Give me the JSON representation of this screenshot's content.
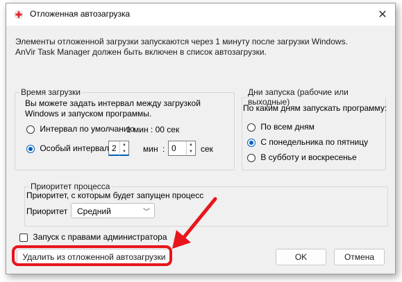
{
  "window": {
    "title": "Отложенная автозагрузка",
    "close_label": "✕"
  },
  "intro": {
    "line1": "Элементы отложенной загрузки запускаются через 1 минуту после загрузки Windows.",
    "line2": "AnVir Task Manager должен быть включен в список автозагрузки."
  },
  "time_group": {
    "legend": "Время загрузки",
    "desc1": "Вы можете задать интервал между загрузкой",
    "desc2": "Windows и запуском программы.",
    "default_label": "Интервал по умолчанию",
    "default_value": "1 мин : 00 сек",
    "custom_label": "Особый интервал",
    "minutes_value": "2",
    "minutes_unit": "мин",
    "colon": ":",
    "seconds_value": "0",
    "seconds_unit": "сек",
    "selected": "custom"
  },
  "days_group": {
    "legend": "Дни запуска (рабочие или выходные)",
    "question": "По каким дням запускать программу:",
    "options": [
      "По всем дням",
      "С понедельника по пятницу",
      "В субботу и воскресенье"
    ],
    "selected_index": 1
  },
  "priority_group": {
    "legend": "Приоритет процесса",
    "desc": "Приоритет, с которым будет запущен процесс",
    "label": "Приоритет",
    "value": "Средний"
  },
  "admin": {
    "label": "Запуск с правами администратора",
    "checked": false
  },
  "buttons": {
    "remove": "Удалить из отложенной автозагрузки",
    "ok": "OK",
    "cancel": "Отмена"
  },
  "colors": {
    "accent": "#005fb8",
    "highlight": "#e8151b"
  }
}
